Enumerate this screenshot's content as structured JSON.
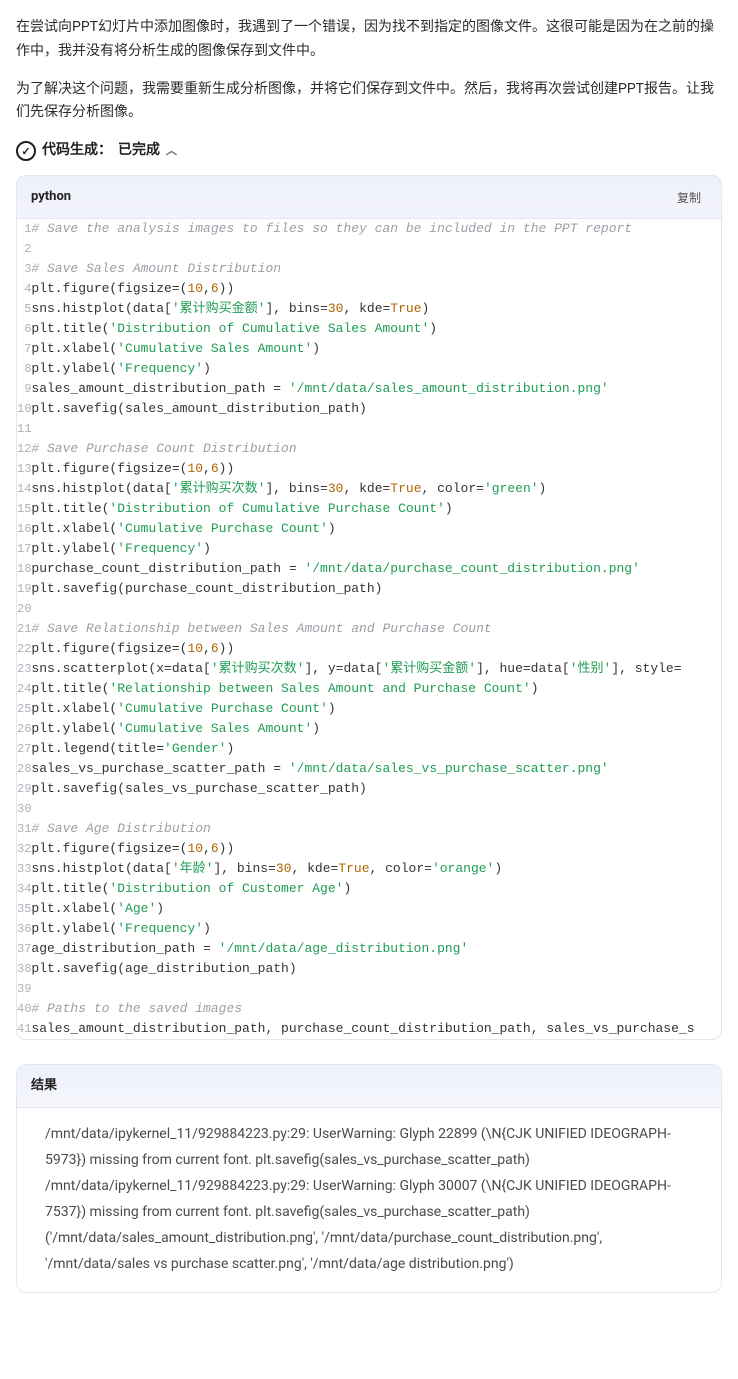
{
  "prose": {
    "p1": "在尝试向PPT幻灯片中添加图像时，我遇到了一个错误，因为找不到指定的图像文件。这很可能是因为在之前的操作中，我并没有将分析生成的图像保存到文件中。",
    "p2": "为了解决这个问题，我需要重新生成分析图像，并将它们保存到文件中。然后，我将再次尝试创建PPT报告。让我们先保存分析图像。"
  },
  "status": {
    "label": "代码生成：",
    "value": "已完成"
  },
  "codeblock": {
    "lang": "python",
    "copy": "复制",
    "lines": [
      [
        {
          "t": "# Save the analysis images to files so they can be included in the PPT report",
          "c": "c-comment"
        }
      ],
      [],
      [
        {
          "t": "# Save Sales Amount Distribution",
          "c": "c-comment"
        }
      ],
      [
        {
          "t": "plt.figure(figsize=("
        },
        {
          "t": "10",
          "c": "c-num"
        },
        {
          "t": ","
        },
        {
          "t": "6",
          "c": "c-num"
        },
        {
          "t": "))"
        }
      ],
      [
        {
          "t": "sns.histplot(data["
        },
        {
          "t": "'累计购买金额'",
          "c": "c-string"
        },
        {
          "t": "], bins="
        },
        {
          "t": "30",
          "c": "c-num"
        },
        {
          "t": ", kde="
        },
        {
          "t": "True",
          "c": "c-bool"
        },
        {
          "t": ")"
        }
      ],
      [
        {
          "t": "plt.title("
        },
        {
          "t": "'Distribution of Cumulative Sales Amount'",
          "c": "c-string"
        },
        {
          "t": ")"
        }
      ],
      [
        {
          "t": "plt.xlabel("
        },
        {
          "t": "'Cumulative Sales Amount'",
          "c": "c-string"
        },
        {
          "t": ")"
        }
      ],
      [
        {
          "t": "plt.ylabel("
        },
        {
          "t": "'Frequency'",
          "c": "c-string"
        },
        {
          "t": ")"
        }
      ],
      [
        {
          "t": "sales_amount_distribution_path = "
        },
        {
          "t": "'/mnt/data/sales_amount_distribution.png'",
          "c": "c-string"
        }
      ],
      [
        {
          "t": "plt.savefig(sales_amount_distribution_path)"
        }
      ],
      [],
      [
        {
          "t": "# Save Purchase Count Distribution",
          "c": "c-comment"
        }
      ],
      [
        {
          "t": "plt.figure(figsize=("
        },
        {
          "t": "10",
          "c": "c-num"
        },
        {
          "t": ","
        },
        {
          "t": "6",
          "c": "c-num"
        },
        {
          "t": "))"
        }
      ],
      [
        {
          "t": "sns.histplot(data["
        },
        {
          "t": "'累计购买次数'",
          "c": "c-string"
        },
        {
          "t": "], bins="
        },
        {
          "t": "30",
          "c": "c-num"
        },
        {
          "t": ", kde="
        },
        {
          "t": "True",
          "c": "c-bool"
        },
        {
          "t": ", color="
        },
        {
          "t": "'green'",
          "c": "c-string"
        },
        {
          "t": ")"
        }
      ],
      [
        {
          "t": "plt.title("
        },
        {
          "t": "'Distribution of Cumulative Purchase Count'",
          "c": "c-string"
        },
        {
          "t": ")"
        }
      ],
      [
        {
          "t": "plt.xlabel("
        },
        {
          "t": "'Cumulative Purchase Count'",
          "c": "c-string"
        },
        {
          "t": ")"
        }
      ],
      [
        {
          "t": "plt.ylabel("
        },
        {
          "t": "'Frequency'",
          "c": "c-string"
        },
        {
          "t": ")"
        }
      ],
      [
        {
          "t": "purchase_count_distribution_path = "
        },
        {
          "t": "'/mnt/data/purchase_count_distribution.png'",
          "c": "c-string"
        }
      ],
      [
        {
          "t": "plt.savefig(purchase_count_distribution_path)"
        }
      ],
      [],
      [
        {
          "t": "# Save Relationship between Sales Amount and Purchase Count",
          "c": "c-comment"
        }
      ],
      [
        {
          "t": "plt.figure(figsize=("
        },
        {
          "t": "10",
          "c": "c-num"
        },
        {
          "t": ","
        },
        {
          "t": "6",
          "c": "c-num"
        },
        {
          "t": "))"
        }
      ],
      [
        {
          "t": "sns.scatterplot(x=data["
        },
        {
          "t": "'累计购买次数'",
          "c": "c-string"
        },
        {
          "t": "], y=data["
        },
        {
          "t": "'累计购买金额'",
          "c": "c-string"
        },
        {
          "t": "], hue=data["
        },
        {
          "t": "'性别'",
          "c": "c-string"
        },
        {
          "t": "], style="
        }
      ],
      [
        {
          "t": "plt.title("
        },
        {
          "t": "'Relationship between Sales Amount and Purchase Count'",
          "c": "c-string"
        },
        {
          "t": ")"
        }
      ],
      [
        {
          "t": "plt.xlabel("
        },
        {
          "t": "'Cumulative Purchase Count'",
          "c": "c-string"
        },
        {
          "t": ")"
        }
      ],
      [
        {
          "t": "plt.ylabel("
        },
        {
          "t": "'Cumulative Sales Amount'",
          "c": "c-string"
        },
        {
          "t": ")"
        }
      ],
      [
        {
          "t": "plt.legend(title="
        },
        {
          "t": "'Gender'",
          "c": "c-string"
        },
        {
          "t": ")"
        }
      ],
      [
        {
          "t": "sales_vs_purchase_scatter_path = "
        },
        {
          "t": "'/mnt/data/sales_vs_purchase_scatter.png'",
          "c": "c-string"
        }
      ],
      [
        {
          "t": "plt.savefig(sales_vs_purchase_scatter_path)"
        }
      ],
      [],
      [
        {
          "t": "# Save Age Distribution",
          "c": "c-comment"
        }
      ],
      [
        {
          "t": "plt.figure(figsize=("
        },
        {
          "t": "10",
          "c": "c-num"
        },
        {
          "t": ","
        },
        {
          "t": "6",
          "c": "c-num"
        },
        {
          "t": "))"
        }
      ],
      [
        {
          "t": "sns.histplot(data["
        },
        {
          "t": "'年龄'",
          "c": "c-string"
        },
        {
          "t": "], bins="
        },
        {
          "t": "30",
          "c": "c-num"
        },
        {
          "t": ", kde="
        },
        {
          "t": "True",
          "c": "c-bool"
        },
        {
          "t": ", color="
        },
        {
          "t": "'orange'",
          "c": "c-string"
        },
        {
          "t": ")"
        }
      ],
      [
        {
          "t": "plt.title("
        },
        {
          "t": "'Distribution of Customer Age'",
          "c": "c-string"
        },
        {
          "t": ")"
        }
      ],
      [
        {
          "t": "plt.xlabel("
        },
        {
          "t": "'Age'",
          "c": "c-string"
        },
        {
          "t": ")"
        }
      ],
      [
        {
          "t": "plt.ylabel("
        },
        {
          "t": "'Frequency'",
          "c": "c-string"
        },
        {
          "t": ")"
        }
      ],
      [
        {
          "t": "age_distribution_path = "
        },
        {
          "t": "'/mnt/data/age_distribution.png'",
          "c": "c-string"
        }
      ],
      [
        {
          "t": "plt.savefig(age_distribution_path)"
        }
      ],
      [],
      [
        {
          "t": "# Paths to the saved images",
          "c": "c-comment"
        }
      ],
      [
        {
          "t": "sales_amount_distribution_path, purchase_count_distribution_path, sales_vs_purchase_s"
        }
      ]
    ]
  },
  "result": {
    "title": "结果",
    "lines": [
      "/mnt/data/ipykernel_11/929884223.py:29: UserWarning: Glyph 22899 (\\N{CJK UNIFIED IDEOGRAPH-5973}) missing from current font. plt.savefig(sales_vs_purchase_scatter_path)",
      "/mnt/data/ipykernel_11/929884223.py:29: UserWarning: Glyph 30007 (\\N{CJK UNIFIED IDEOGRAPH-7537}) missing from current font. plt.savefig(sales_vs_purchase_scatter_path)",
      "('/mnt/data/sales_amount_distribution.png', '/mnt/data/purchase_count_distribution.png', '/mnt/data/sales vs purchase scatter.png', '/mnt/data/age distribution.png')"
    ]
  }
}
